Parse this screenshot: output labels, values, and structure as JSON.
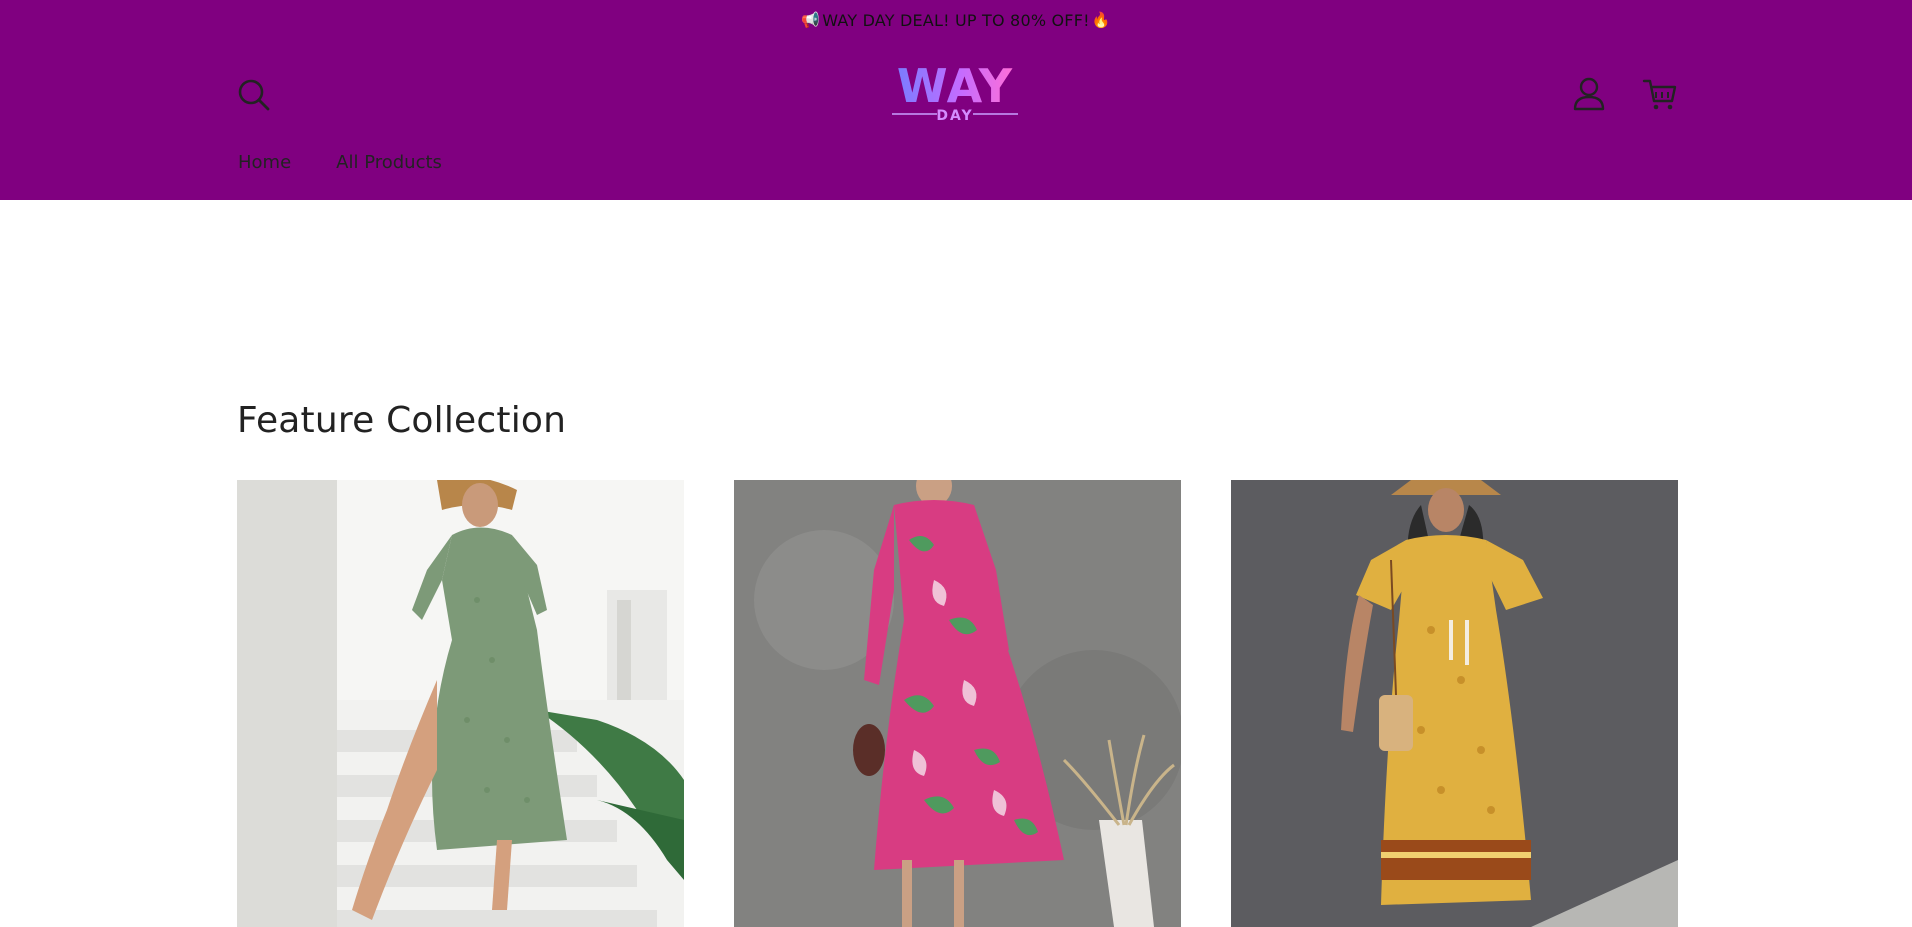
{
  "announcement": {
    "text": "WAY DAY DEAL! UP TO 80% OFF!",
    "lead_icon": "megaphone-icon",
    "trail_icon": "fire-icon"
  },
  "header": {
    "background": "#800080",
    "logo": {
      "main": "WAY",
      "sub": "DAY"
    },
    "icons": [
      "search-icon",
      "account-icon",
      "cart-icon"
    ]
  },
  "nav": {
    "items": [
      {
        "label": "Home"
      },
      {
        "label": "All Products"
      }
    ]
  },
  "collection": {
    "title": "Feature Collection",
    "products": [
      {
        "image": "green-floral-dress-photo",
        "dress_color": "#7d9a78"
      },
      {
        "image": "pink-leaf-print-dress-photo",
        "dress_color": "#d83c82"
      },
      {
        "image": "yellow-boho-dress-photo",
        "dress_color": "#e0b040"
      }
    ]
  }
}
